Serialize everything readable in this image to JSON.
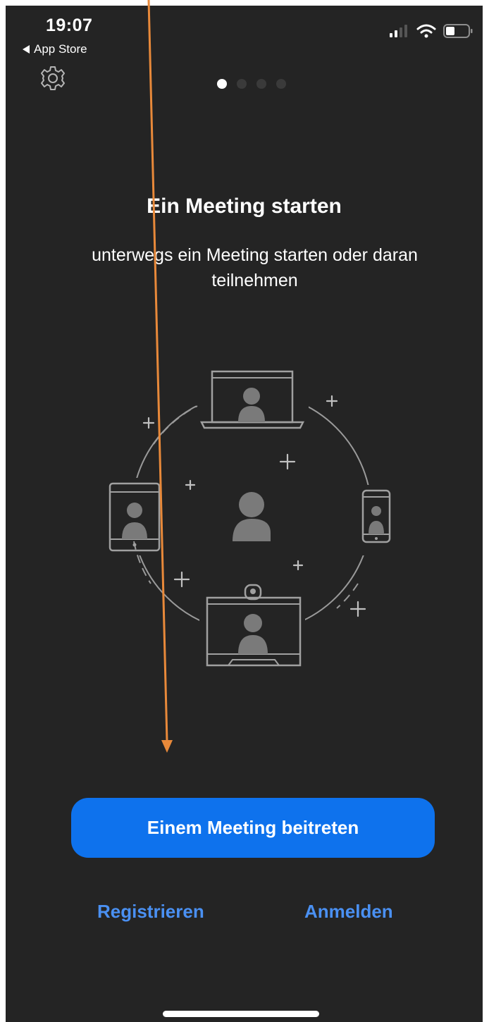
{
  "status_bar": {
    "time": "19:07",
    "back_label": "App Store",
    "icons": [
      "cellular-signal-icon",
      "wifi-icon",
      "battery-icon"
    ]
  },
  "header": {
    "settings_icon": "gear-icon"
  },
  "pager": {
    "total": 4,
    "active_index": 0
  },
  "onboarding": {
    "title": "Ein Meeting starten",
    "subtitle": "unterwegs ein Meeting starten oder daran teilnehmen"
  },
  "actions": {
    "join_label": "Einem Meeting beitreten",
    "register_label": "Registrieren",
    "login_label": "Anmelden"
  },
  "colors": {
    "background": "#242424",
    "primary_button": "#0e72ed",
    "link": "#4a90f2",
    "annotation_arrow": "#e8893a"
  }
}
